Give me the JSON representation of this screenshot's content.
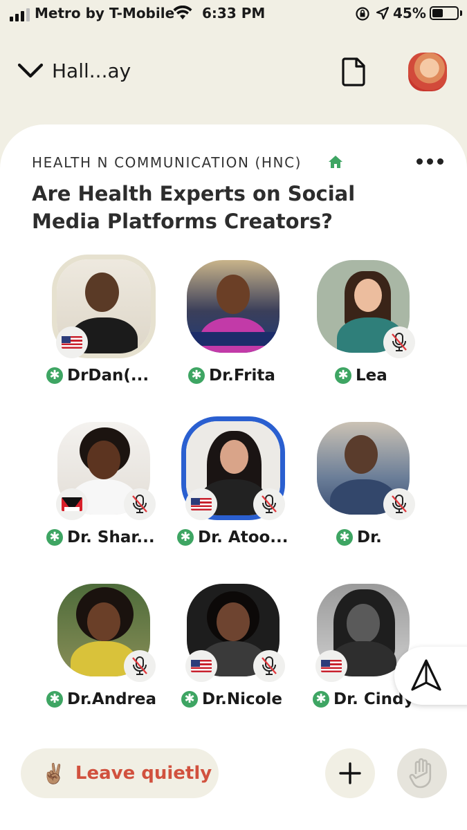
{
  "status_bar": {
    "carrier": "Metro by T-Mobile",
    "time": "6:33 PM",
    "battery": "45%",
    "battery_level": 0.45
  },
  "top_bar": {
    "back_label": "Hall...ay",
    "icons": [
      "chevron-down-icon",
      "document-icon"
    ]
  },
  "room": {
    "club_name": "HEALTH N COMMUNICATION (HNC)",
    "title": "Are Health Experts on Social Media Platforms Creators?",
    "speakers": [
      {
        "name": "DrDan(...",
        "flag": "US",
        "muted": false,
        "ring": "speaking"
      },
      {
        "name": "Dr.Frita",
        "flag": null,
        "muted": false,
        "ring": null
      },
      {
        "name": "Lea",
        "flag": null,
        "muted": true,
        "ring": null
      },
      {
        "name": "Dr. Shar...",
        "flag": "AG",
        "muted": true,
        "ring": null
      },
      {
        "name": "Dr. Atoo...",
        "flag": "US",
        "muted": true,
        "ring": "blue"
      },
      {
        "name": "Dr.",
        "flag": null,
        "muted": true,
        "ring": null
      },
      {
        "name": "Dr.Andrea",
        "flag": null,
        "muted": true,
        "ring": null
      },
      {
        "name": "Dr.Nicole",
        "flag": "US",
        "muted": true,
        "ring": null
      },
      {
        "name": "Dr. Cindy",
        "flag": "US",
        "muted": true,
        "ring": null
      }
    ],
    "moderator_symbol": "✱"
  },
  "bottom_bar": {
    "leave_label": "Leave quietly",
    "leave_emoji": "✌🏽"
  },
  "colors": {
    "background": "#f1efe4",
    "leave_text": "#d1513e",
    "moderator_badge": "#3ea563",
    "club_home": "#3ea563",
    "ring_blue": "#2a5fd0"
  }
}
